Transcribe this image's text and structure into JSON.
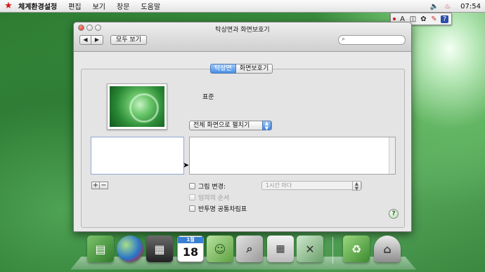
{
  "menubar": {
    "app_name": "체계환경설정",
    "items": [
      "편집",
      "보기",
      "창문",
      "도움말"
    ],
    "clock": "07:54"
  },
  "window": {
    "title": "탁상면과 화면보호기",
    "back_label": "◀",
    "forward_label": "▶",
    "show_all_label": "모두 보기",
    "search_placeholder": ""
  },
  "tabs": [
    {
      "label": "탁상면",
      "active": true
    },
    {
      "label": "화면보호기",
      "active": false
    }
  ],
  "desktop": {
    "style_label": "표준",
    "fit_option": "전체 화면으로 펼치기",
    "add_label": "+",
    "remove_label": "−",
    "change_picture_label": "그림 변경:",
    "interval_option": "1시간 마다",
    "random_order_label": "임의의 순서",
    "translucent_menubar_label": "반투명 공통차림표",
    "help_label": "?"
  },
  "dock": {
    "items": [
      "folder-icon",
      "globe-icon",
      "movie-clapper-icon",
      "calendar-icon",
      "address-book-icon",
      "preview-icon",
      "calculator-icon",
      "system-preferences-icon",
      "recycle-folder-icon",
      "trash-icon"
    ],
    "calendar_day": "18",
    "calendar_month": "1월"
  }
}
